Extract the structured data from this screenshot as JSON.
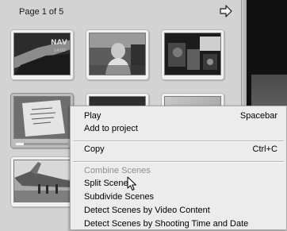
{
  "album": {
    "page_label": "Page 1 of 5",
    "thumbnails": [
      {
        "scene": "navy-aircraft",
        "selected": false
      },
      {
        "scene": "person-outdoors",
        "selected": false
      },
      {
        "scene": "cockpit-equipment",
        "selected": false
      },
      {
        "scene": "paper-document",
        "selected": true,
        "progress": 0.15
      },
      {
        "scene": "dark-clip",
        "selected": false
      },
      {
        "scene": "bright-clip",
        "selected": false
      },
      {
        "scene": "airplane-on-deck",
        "selected": false
      }
    ]
  },
  "icons": {
    "next_page": "arrow-right-icon",
    "cursor": "mouse-pointer-icon"
  },
  "context_menu": {
    "items": [
      {
        "label": "Play",
        "shortcut": "Spacebar",
        "enabled": true
      },
      {
        "label": "Add to project",
        "shortcut": "",
        "enabled": true
      },
      {
        "label": "Copy",
        "shortcut": "Ctrl+C",
        "enabled": true
      },
      {
        "label": "Combine Scenes",
        "shortcut": "",
        "enabled": false
      },
      {
        "label": "Split Scene",
        "shortcut": "",
        "enabled": true
      },
      {
        "label": "Subdivide Scenes",
        "shortcut": "",
        "enabled": true
      },
      {
        "label": "Detect Scenes by Video Content",
        "shortcut": "",
        "enabled": true
      },
      {
        "label": "Detect Scenes by Shooting Time and Date",
        "shortcut": "",
        "enabled": true
      }
    ]
  },
  "colors": {
    "panel_bg": "#d3d3d3",
    "menu_bg": "#ececec",
    "disabled_text": "#8e8e8e"
  }
}
